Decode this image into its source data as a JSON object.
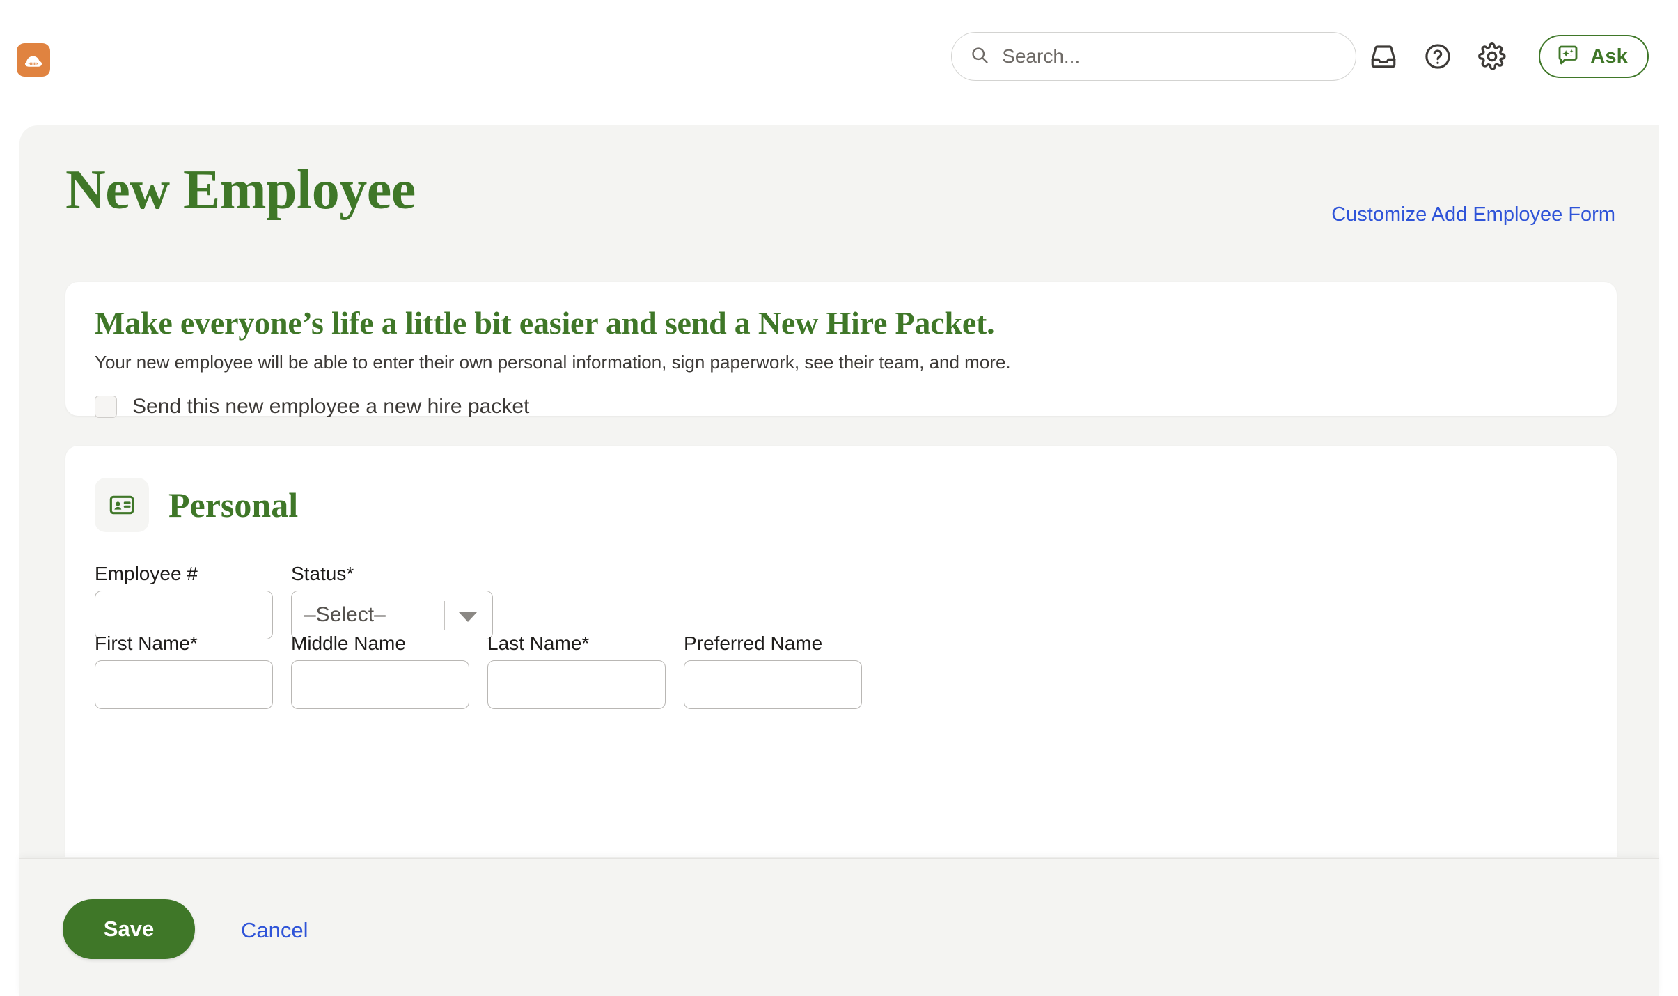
{
  "header": {
    "logo_icon": "bamboo-cloud-logo",
    "logo_color": "#e08340",
    "search": {
      "placeholder": "Search...",
      "value": "",
      "icon": "search-icon"
    },
    "icons": [
      {
        "name": "inbox-icon",
        "label": "Inbox"
      },
      {
        "name": "help-circle-icon",
        "label": "Help"
      },
      {
        "name": "gear-icon",
        "label": "Settings"
      }
    ],
    "ask": {
      "label": "Ask",
      "icon": "ask-sparkle-chat-icon",
      "color": "#3f7728"
    }
  },
  "page": {
    "title": "New Employee",
    "title_color": "#3f7728",
    "customize_link": "Customize Add Employee Form",
    "link_color": "#2f54d8"
  },
  "packet_card": {
    "heading": "Make everyone’s life a little bit easier and send a New Hire Packet.",
    "subtext": "Your new employee will be able to enter their own personal information, sign paperwork, see their team, and more.",
    "checkbox_label": "Send this new employee a new hire packet",
    "checkbox_checked": false
  },
  "personal_card": {
    "icon": "id-card-icon",
    "title": "Personal",
    "rows": [
      {
        "fields": [
          {
            "label": "Employee #",
            "type": "text",
            "value": "",
            "required": false,
            "name": "employee-number-field"
          },
          {
            "label": "Status*",
            "type": "select",
            "value": "–Select–",
            "required": true,
            "name": "status-select"
          }
        ]
      },
      {
        "fields": [
          {
            "label": "First Name*",
            "type": "text",
            "value": "",
            "required": true,
            "name": "first-name-field"
          },
          {
            "label": "Middle Name",
            "type": "text",
            "value": "",
            "required": false,
            "name": "middle-name-field"
          },
          {
            "label": "Last Name*",
            "type": "text",
            "value": "",
            "required": true,
            "name": "last-name-field"
          },
          {
            "label": "Preferred Name",
            "type": "text",
            "value": "",
            "required": false,
            "name": "preferred-name-field"
          }
        ]
      }
    ]
  },
  "footer": {
    "save_label": "Save",
    "save_color": "#3f7728",
    "cancel_label": "Cancel",
    "cancel_color": "#2f54d8"
  }
}
